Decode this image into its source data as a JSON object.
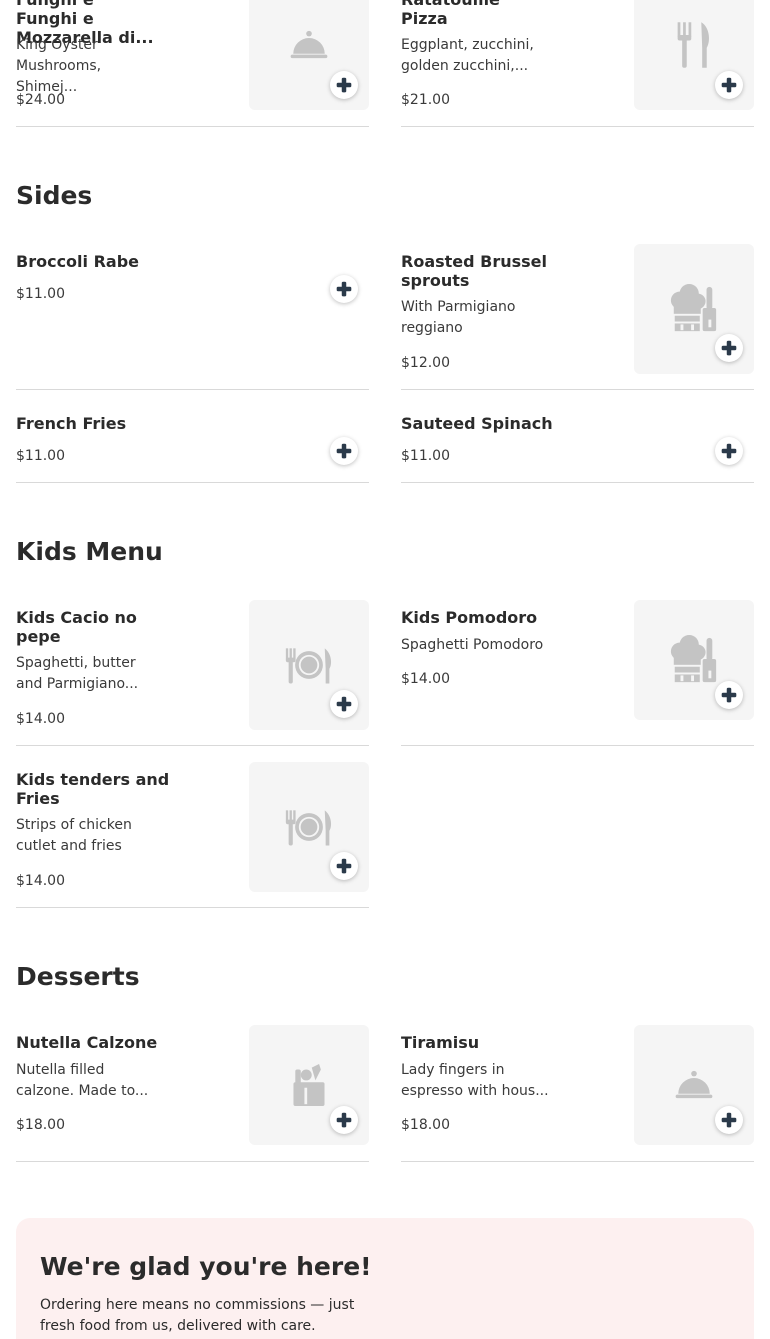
{
  "colors": {
    "accent": "#2b3a4a",
    "thumb_bg": "#f5f5f5",
    "icon": "#c4c4c4",
    "banner_bg": "#fdf0f0",
    "divider": "#d9d9d9"
  },
  "top_items": [
    {
      "name": "Funghi e Mozzarella di...",
      "desc": "King Oyster Mushrooms, Shimej...",
      "price": "$24.00",
      "icon": "cloche-icon"
    },
    {
      "name": "Ratatouille Pizza",
      "desc": "Eggplant, zucchini, golden zucchini,...",
      "price": "$21.00",
      "icon": "fork-knife-icon"
    }
  ],
  "sections": {
    "sides": {
      "title": "Sides",
      "items": [
        {
          "name": "Broccoli Rabe",
          "price": "$11.00"
        },
        {
          "name": "Roasted Brussel sprouts",
          "desc": "With Parmigiano reggiano",
          "price": "$12.00",
          "icon": "chef-icon"
        },
        {
          "name": "French Fries",
          "price": "$11.00"
        },
        {
          "name": "Sauteed Spinach",
          "price": "$11.00"
        }
      ]
    },
    "kids": {
      "title": "Kids Menu",
      "items": [
        {
          "name": "Kids Cacio no pepe",
          "desc": "Spaghetti, butter and Parmigiano...",
          "price": "$14.00",
          "icon": "plate-utensils-icon"
        },
        {
          "name": "Kids Pomodoro",
          "desc": "Spaghetti Pomodoro",
          "price": "$14.00",
          "icon": "chef-icon"
        },
        {
          "name": "Kids tenders and Fries",
          "desc": "Strips of chicken cutlet and fries",
          "price": "$14.00",
          "icon": "plate-utensils-icon"
        }
      ]
    },
    "desserts": {
      "title": "Desserts",
      "items": [
        {
          "name": "Nutella Calzone",
          "desc": "Nutella filled calzone. Made to...",
          "price": "$18.00",
          "icon": "grocery-bag-icon"
        },
        {
          "name": "Tiramisu",
          "desc": "Lady fingers in espresso with hous...",
          "price": "$18.00",
          "icon": "cloche-icon"
        }
      ]
    }
  },
  "banner": {
    "title": "We're glad you're here!",
    "text": "Ordering here means no commissions — just fresh food from us, delivered with care."
  }
}
